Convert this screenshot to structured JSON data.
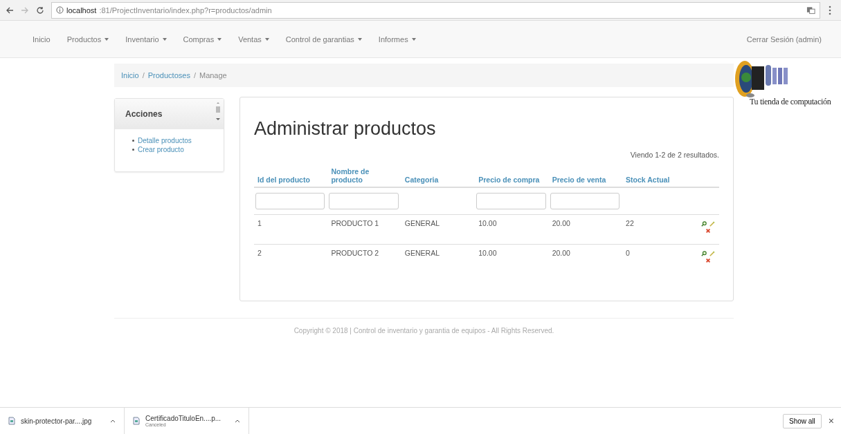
{
  "browser": {
    "url_host": "localhost",
    "url_rest": ":81/ProjectInventario/index.php?r=productos/admin"
  },
  "navbar": {
    "items": [
      {
        "label": "Inicio",
        "dropdown": false
      },
      {
        "label": "Productos",
        "dropdown": true
      },
      {
        "label": "Inventario",
        "dropdown": true
      },
      {
        "label": "Compras",
        "dropdown": true
      },
      {
        "label": "Ventas",
        "dropdown": true
      },
      {
        "label": "Control de garantias",
        "dropdown": true
      },
      {
        "label": "Informes",
        "dropdown": true
      }
    ],
    "logout": "Cerrar Sesión (admin)"
  },
  "breadcrumb": {
    "separator": "/",
    "items": [
      {
        "label": "Inicio",
        "link": true
      },
      {
        "label": "Productoses",
        "link": true
      },
      {
        "label": "Manage",
        "link": false
      }
    ]
  },
  "logo": {
    "tagline": "Tu tienda de computación"
  },
  "sidebar": {
    "title": "Acciones",
    "items": [
      "Detalle productos",
      "Crear producto"
    ]
  },
  "main": {
    "title": "Administrar productos",
    "summary": "Viendo 1-2 de 2 resultados.",
    "columns": [
      {
        "label": "Id del producto",
        "filter": true
      },
      {
        "label": "Nombre de producto",
        "filter": true
      },
      {
        "label": "Categoria",
        "filter": false
      },
      {
        "label": "Precio de compra",
        "filter": true
      },
      {
        "label": "Precio de venta",
        "filter": true
      },
      {
        "label": "Stock Actual",
        "filter": false
      }
    ],
    "rows": [
      [
        "1",
        "PRODUCTO 1",
        "GENERAL",
        "10.00",
        "20.00",
        "22"
      ],
      [
        "2",
        "PRODUCTO 2",
        "GENERAL",
        "10.00",
        "20.00",
        "0"
      ]
    ]
  },
  "footer": "Copyright © 2018 | Control de inventario y garantia de equipos - All Rights Reserved.",
  "downloads": {
    "items": [
      {
        "name": "skin-protector-par....jpg"
      },
      {
        "name": "CertificadoTituloEn....p...",
        "status": "Canceled"
      }
    ],
    "show_all": "Show all",
    "close": "×"
  }
}
